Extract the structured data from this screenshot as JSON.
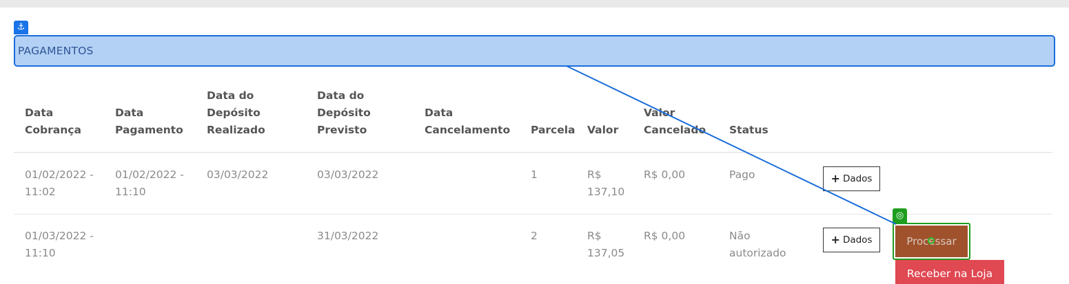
{
  "section": {
    "title": "PAGAMENTOS",
    "anchor_icon": "⚓",
    "target_icon": "◎"
  },
  "table": {
    "headers": {
      "data_cobranca": [
        "Data",
        "Cobrança"
      ],
      "data_pagamento": [
        "Data",
        "Pagamento"
      ],
      "deposito_realizado": [
        "Data do",
        "Depósito",
        "Realizado"
      ],
      "deposito_previsto": [
        "Data do",
        "Depósito",
        "Previsto"
      ],
      "cancelamento": [
        "Data",
        "Cancelamento"
      ],
      "parcela": "Parcela",
      "valor": "Valor",
      "valor_cancelado": [
        "Valor",
        "Cancelado"
      ],
      "status": "Status"
    },
    "rows": [
      {
        "data_cobranca": [
          "01/02/2022 -",
          "11:02"
        ],
        "data_pagamento": [
          "01/02/2022 -",
          "11:10"
        ],
        "deposito_realizado": "03/03/2022",
        "deposito_previsto": "03/03/2022",
        "cancelamento": "",
        "parcela": "1",
        "valor": [
          "R$",
          "137,10"
        ],
        "valor_cancelado": "R$ 0,00",
        "status": [
          "Pago"
        ],
        "dados_label": "Dados"
      },
      {
        "data_cobranca": [
          "01/03/2022 -",
          "11:10"
        ],
        "data_pagamento": [
          "",
          ""
        ],
        "deposito_realizado": "",
        "deposito_previsto": "31/03/2022",
        "cancelamento": "",
        "parcela": "2",
        "valor": [
          "R$",
          "137,05"
        ],
        "valor_cancelado": "R$ 0,00",
        "status": [
          "Não",
          "autorizado"
        ],
        "dados_label": "Dados",
        "processar_label": "Processar",
        "receber_label": "Receber na Loja"
      }
    ]
  },
  "colors": {
    "header_bg": "#b3d1f5",
    "header_border": "#1a6ddb",
    "processar_bg": "#a0522d",
    "receber_bg": "#e04852",
    "target_green": "#1f9d1f"
  }
}
